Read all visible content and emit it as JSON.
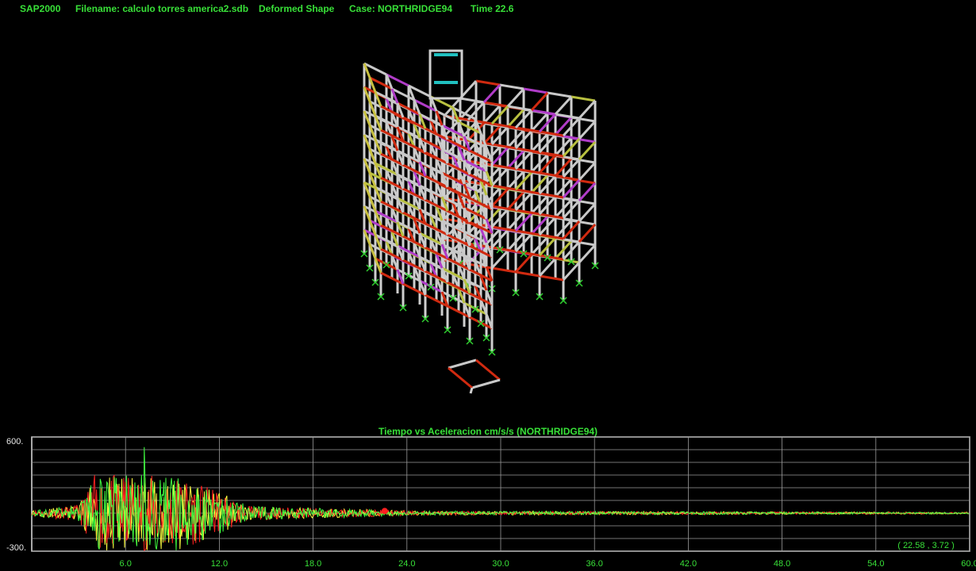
{
  "header": {
    "app": "SAP2000",
    "filename": "Filename: calculo torres america2.sdb",
    "view": "Deformed Shape",
    "case": "Case: NORTHRIDGE94",
    "time": "Time 22.6"
  },
  "model": {
    "description_icon": "3d-frame-model"
  },
  "chart_data": {
    "type": "line",
    "title": "Tiempo vs Aceleracion cm/s/s (NORTHRIDGE94)",
    "xlim": [
      0,
      60
    ],
    "ylim": [
      -300,
      600
    ],
    "x_ticks": [
      "6.0",
      "12.0",
      "18.0",
      "24.0",
      "30.0",
      "36.0",
      "42.0",
      "48.0",
      "54.0",
      "60.0"
    ],
    "y_ticks": [
      "600.",
      "-300."
    ],
    "grid": true,
    "cursor": {
      "x": 22.58,
      "y": 3.72,
      "label": "( 22.58 , 3.72 )"
    },
    "series": [
      {
        "color": "#ff2020"
      },
      {
        "color": "#ffff40"
      },
      {
        "color": "#40ff40"
      }
    ]
  }
}
